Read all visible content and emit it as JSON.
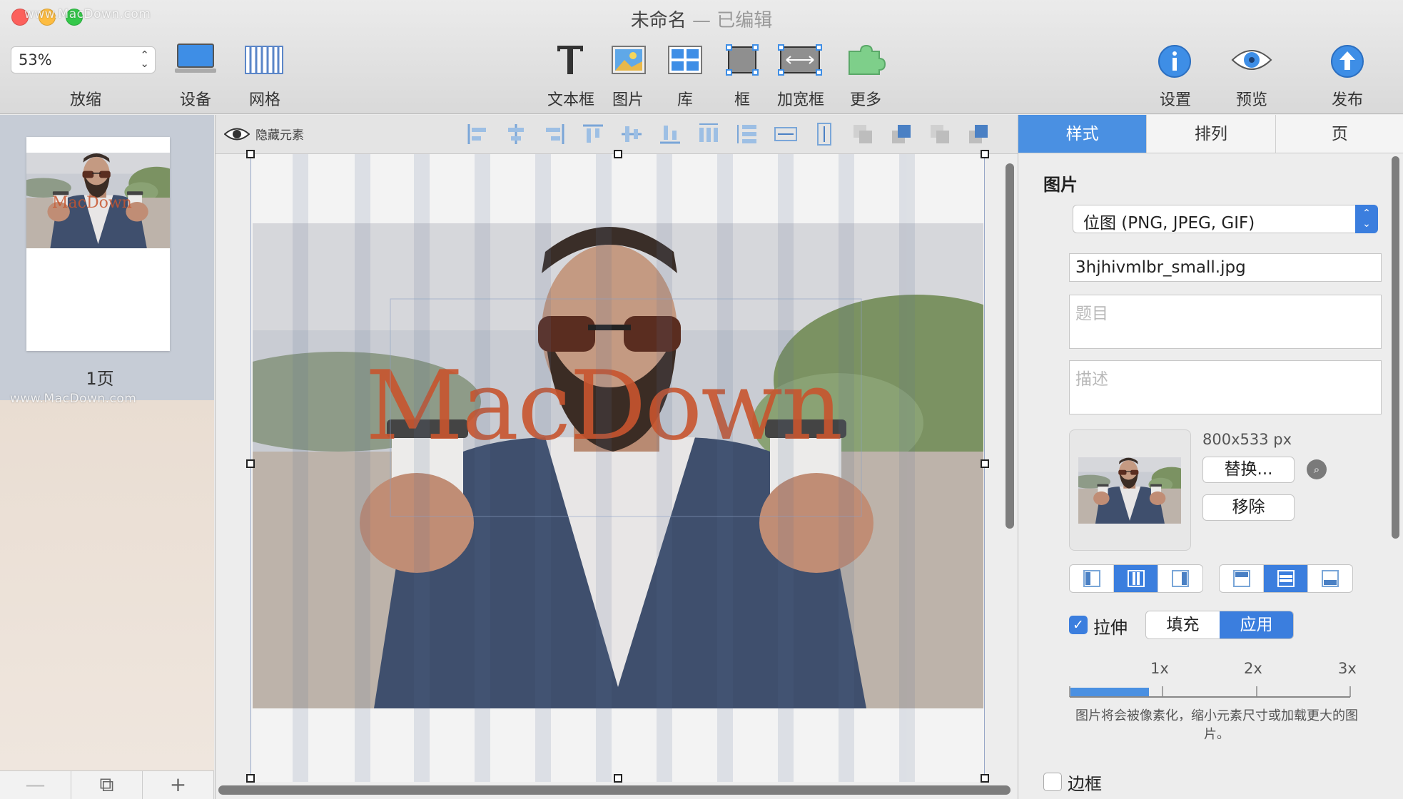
{
  "window": {
    "title": "未命名",
    "title_status": "— 已编辑",
    "watermark": "www.MacDown.com"
  },
  "toolbar": {
    "zoom_value": "53%",
    "zoom_label": "放缩",
    "device_label": "设备",
    "grid_label": "网格",
    "textbox_label": "文本框",
    "image_label": "图片",
    "library_label": "库",
    "frame_label": "框",
    "wide_frame_label": "加宽框",
    "more_label": "更多",
    "settings_label": "设置",
    "preview_label": "预览",
    "publish_label": "发布"
  },
  "pages_panel": {
    "page_label": "1页",
    "thumb_watermark": "MacDown",
    "bottom": {
      "remove": "—",
      "duplicate": "⧉",
      "add": "+"
    }
  },
  "canvas": {
    "hide_elements_label": "隐藏元素",
    "watermark_text": "MacDown"
  },
  "inspector": {
    "tabs": [
      "样式",
      "排列",
      "页"
    ],
    "section_title": "图片",
    "image_type": "位图 (PNG, JPEG, GIF)",
    "filename": "3hjhivmlbr_small.jpg",
    "title_placeholder": "题目",
    "description_placeholder": "描述",
    "image_dims": "800x533 px",
    "replace_button": "替换...",
    "remove_button": "移除",
    "stretch_label": "拉伸",
    "fill_label": "填充",
    "apply_label": "应用",
    "scale_labels": [
      "1x",
      "2x",
      "3x"
    ],
    "scale_value": 0.28,
    "note": "图片将会被像素化，缩小元素尺寸或加载更大的图片。",
    "border_label": "边框"
  },
  "colors": {
    "accent": "#3b7ede",
    "tab_active": "#4a90e2",
    "watermark_orange": "#c8552e"
  }
}
